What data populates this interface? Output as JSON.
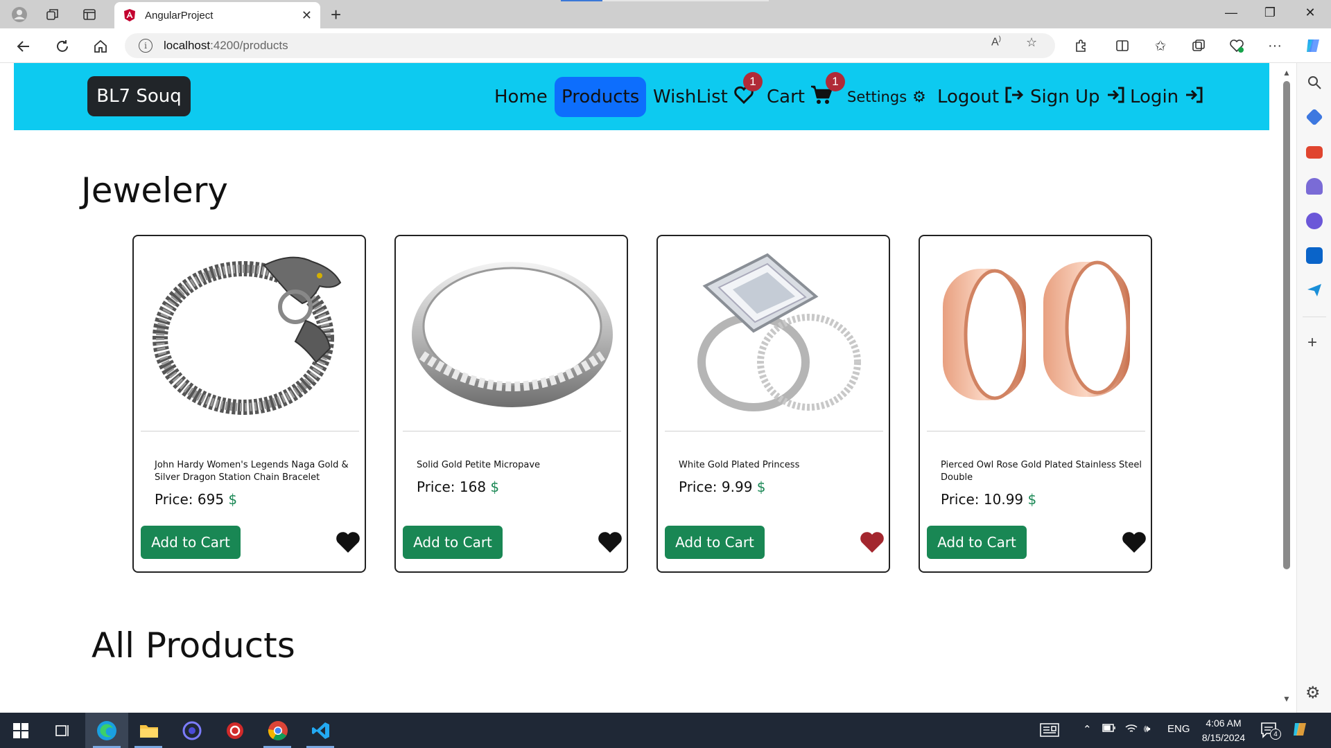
{
  "browser": {
    "tab_title": "AngularProject",
    "url_host": "localhost",
    "url_path": ":4200/products"
  },
  "navbar": {
    "brand": "BL7 Souq",
    "links": {
      "home": "Home",
      "products": "Products",
      "wishlist": "WishList",
      "cart": "Cart",
      "settings": "Settings",
      "logout": "Logout",
      "signup": "Sign Up",
      "login": "Login"
    },
    "wishlist_count": "1",
    "cart_count": "1",
    "accent_color": "#0dcaf0",
    "active_color": "#0d6efd"
  },
  "sections": {
    "featured_title": "Jewelery",
    "all_title": "All Products"
  },
  "products": [
    {
      "name": "John Hardy Women's Legends Naga Gold & Silver Dragon Station Chain Bracelet",
      "price_label": "Price: 695",
      "currency": "$",
      "button": "Add to Cart",
      "wishlisted": false,
      "image": "dragon-bracelet"
    },
    {
      "name": "Solid Gold Petite Micropave",
      "price_label": "Price: 168",
      "currency": "$",
      "button": "Add to Cart",
      "wishlisted": false,
      "image": "silver-band-ring"
    },
    {
      "name": "White Gold Plated Princess",
      "price_label": "Price: 9.99",
      "currency": "$",
      "button": "Add to Cart",
      "wishlisted": true,
      "image": "princess-ring-set"
    },
    {
      "name": "Pierced Owl Rose Gold Plated Stainless Steel Double",
      "price_label": "Price: 10.99",
      "currency": "$",
      "button": "Add to Cart",
      "wishlisted": false,
      "image": "rose-gold-plugs"
    }
  ],
  "taskbar": {
    "language": "ENG",
    "time": "4:06 AM",
    "date": "8/15/2024",
    "notifications": "4"
  }
}
